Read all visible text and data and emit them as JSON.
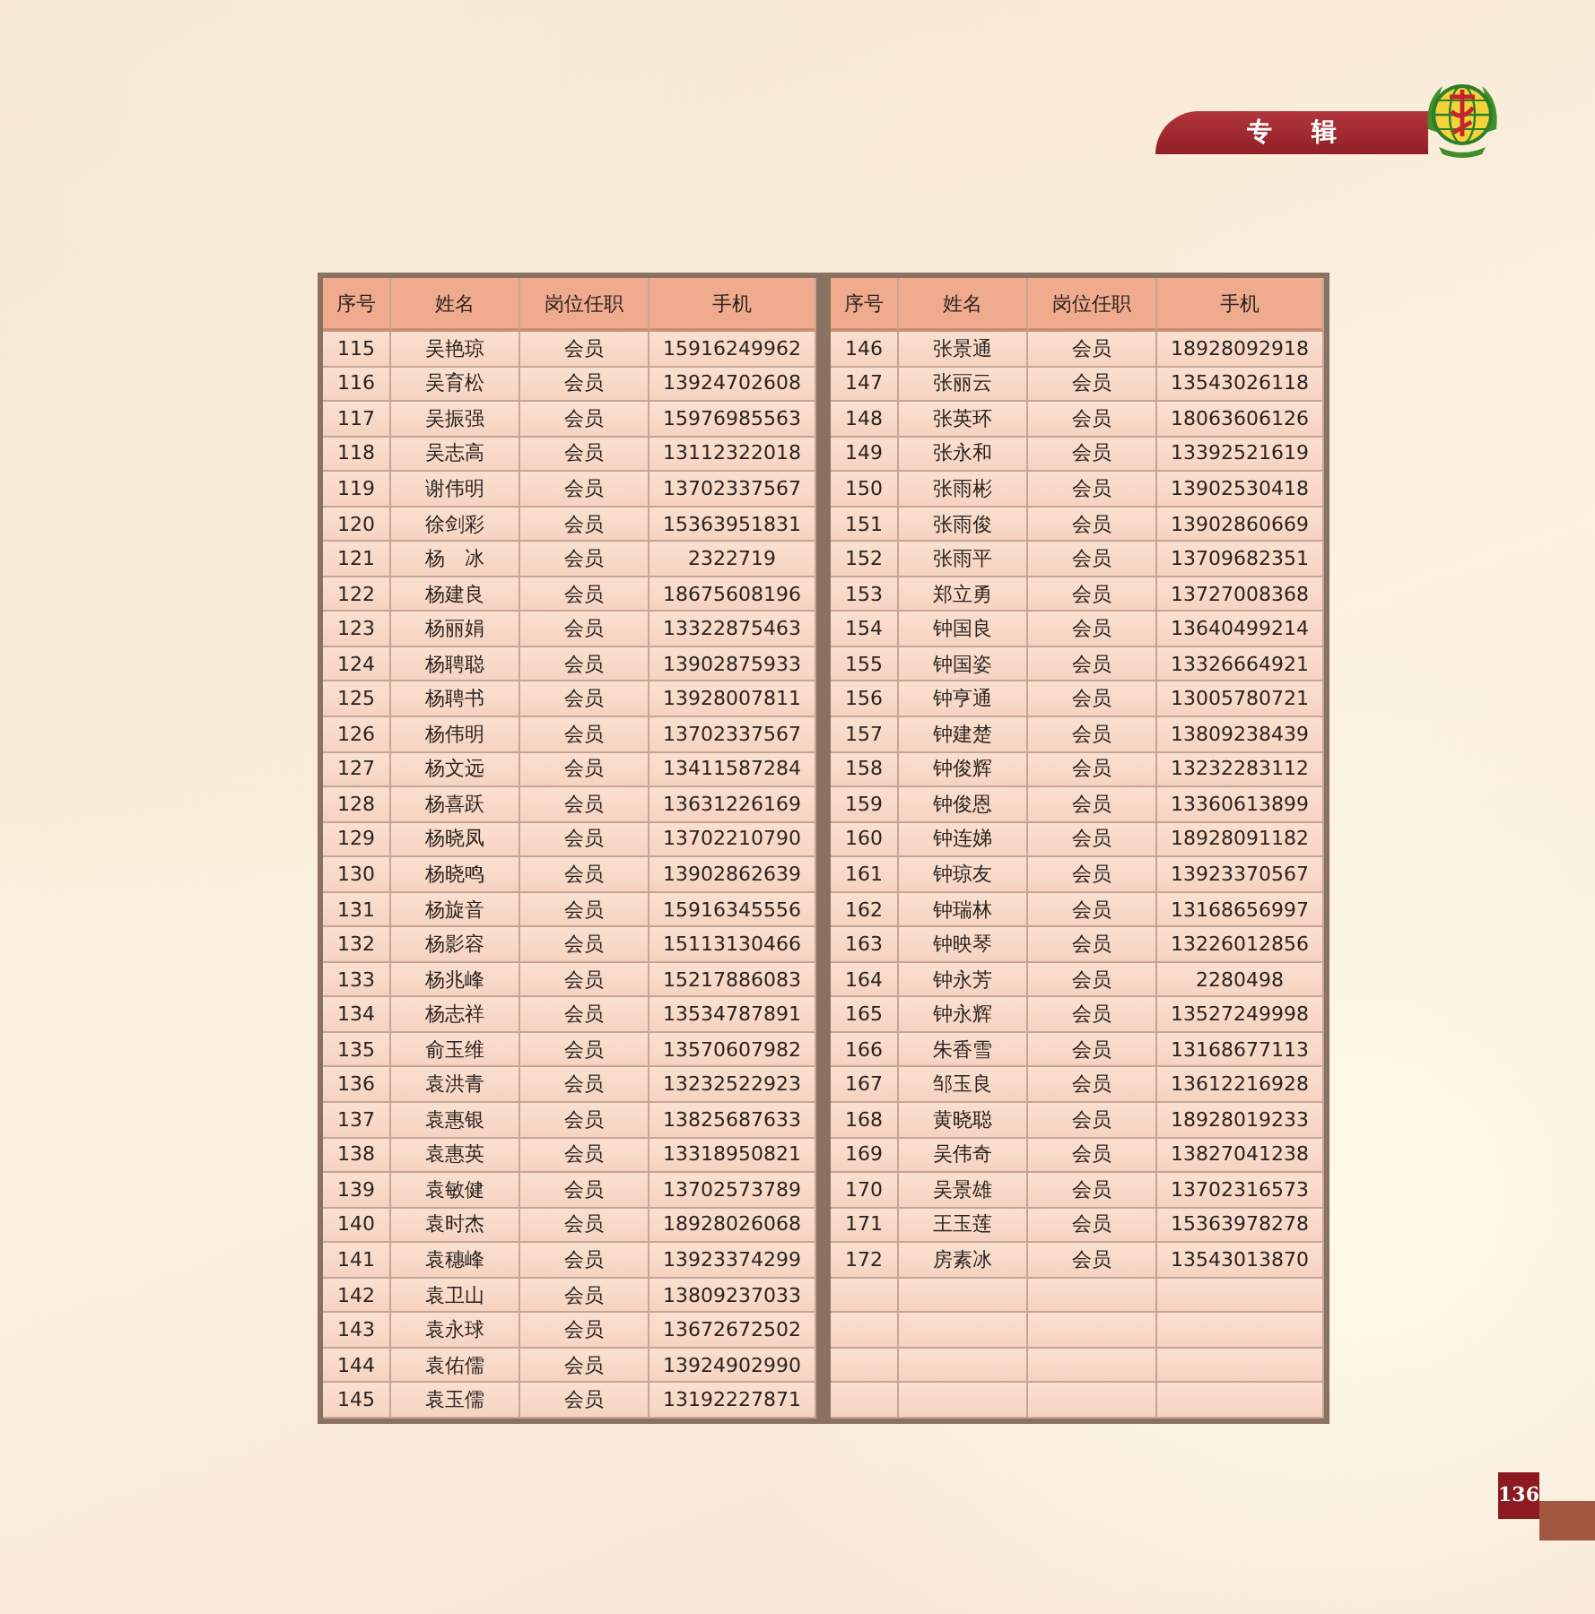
{
  "header": {
    "title": "专辑"
  },
  "tables": [
    {
      "columns": [
        "序号",
        "姓名",
        "岗位任职",
        "手机"
      ],
      "rows": [
        [
          "115",
          "吴艳琼",
          "会员",
          "15916249962"
        ],
        [
          "116",
          "吴育松",
          "会员",
          "13924702608"
        ],
        [
          "117",
          "吴振强",
          "会员",
          "15976985563"
        ],
        [
          "118",
          "吴志高",
          "会员",
          "13112322018"
        ],
        [
          "119",
          "谢伟明",
          "会员",
          "13702337567"
        ],
        [
          "120",
          "徐剑彩",
          "会员",
          "15363951831"
        ],
        [
          "121",
          "杨　冰",
          "会员",
          "2322719"
        ],
        [
          "122",
          "杨建良",
          "会员",
          "18675608196"
        ],
        [
          "123",
          "杨丽娟",
          "会员",
          "13322875463"
        ],
        [
          "124",
          "杨聘聪",
          "会员",
          "13902875933"
        ],
        [
          "125",
          "杨聘书",
          "会员",
          "13928007811"
        ],
        [
          "126",
          "杨伟明",
          "会员",
          "13702337567"
        ],
        [
          "127",
          "杨文远",
          "会员",
          "13411587284"
        ],
        [
          "128",
          "杨喜跃",
          "会员",
          "13631226169"
        ],
        [
          "129",
          "杨晓凤",
          "会员",
          "13702210790"
        ],
        [
          "130",
          "杨晓鸣",
          "会员",
          "13902862639"
        ],
        [
          "131",
          "杨旋音",
          "会员",
          "15916345556"
        ],
        [
          "132",
          "杨影容",
          "会员",
          "15113130466"
        ],
        [
          "133",
          "杨兆峰",
          "会员",
          "15217886083"
        ],
        [
          "134",
          "杨志祥",
          "会员",
          "13534787891"
        ],
        [
          "135",
          "俞玉维",
          "会员",
          "13570607982"
        ],
        [
          "136",
          "袁洪青",
          "会员",
          "13232522923"
        ],
        [
          "137",
          "袁惠银",
          "会员",
          "13825687633"
        ],
        [
          "138",
          "袁惠英",
          "会员",
          "13318950821"
        ],
        [
          "139",
          "袁敏健",
          "会员",
          "13702573789"
        ],
        [
          "140",
          "袁时杰",
          "会员",
          "18928026068"
        ],
        [
          "141",
          "袁穗峰",
          "会员",
          "13923374299"
        ],
        [
          "142",
          "袁卫山",
          "会员",
          "13809237033"
        ],
        [
          "143",
          "袁永球",
          "会员",
          "13672672502"
        ],
        [
          "144",
          "袁佑儒",
          "会员",
          "13924902990"
        ],
        [
          "145",
          "袁玉儒",
          "会员",
          "13192227871"
        ]
      ]
    },
    {
      "columns": [
        "序号",
        "姓名",
        "岗位任职",
        "手机"
      ],
      "rows": [
        [
          "146",
          "张景通",
          "会员",
          "18928092918"
        ],
        [
          "147",
          "张丽云",
          "会员",
          "13543026118"
        ],
        [
          "148",
          "张英环",
          "会员",
          "18063606126"
        ],
        [
          "149",
          "张永和",
          "会员",
          "13392521619"
        ],
        [
          "150",
          "张雨彬",
          "会员",
          "13902530418"
        ],
        [
          "151",
          "张雨俊",
          "会员",
          "13902860669"
        ],
        [
          "152",
          "张雨平",
          "会员",
          "13709682351"
        ],
        [
          "153",
          "郑立勇",
          "会员",
          "13727008368"
        ],
        [
          "154",
          "钟国良",
          "会员",
          "13640499214"
        ],
        [
          "155",
          "钟国姿",
          "会员",
          "13326664921"
        ],
        [
          "156",
          "钟亨通",
          "会员",
          "13005780721"
        ],
        [
          "157",
          "钟建楚",
          "会员",
          "13809238439"
        ],
        [
          "158",
          "钟俊辉",
          "会员",
          "13232283112"
        ],
        [
          "159",
          "钟俊恩",
          "会员",
          "13360613899"
        ],
        [
          "160",
          "钟连娣",
          "会员",
          "18928091182"
        ],
        [
          "161",
          "钟琼友",
          "会员",
          "13923370567"
        ],
        [
          "162",
          "钟瑞林",
          "会员",
          "13168656997"
        ],
        [
          "163",
          "钟映琴",
          "会员",
          "13226012856"
        ],
        [
          "164",
          "钟永芳",
          "会员",
          "2280498"
        ],
        [
          "165",
          "钟永辉",
          "会员",
          "13527249998"
        ],
        [
          "166",
          "朱香雪",
          "会员",
          "13168677113"
        ],
        [
          "167",
          "邹玉良",
          "会员",
          "13612216928"
        ],
        [
          "168",
          "黄晓聪",
          "会员",
          "18928019233"
        ],
        [
          "169",
          "吴伟奇",
          "会员",
          "13827041238"
        ],
        [
          "170",
          "吴景雄",
          "会员",
          "13702316573"
        ],
        [
          "171",
          "王玉莲",
          "会员",
          "15363978278"
        ],
        [
          "172",
          "房素冰",
          "会员",
          "13543013870"
        ]
      ]
    }
  ],
  "page_number": "136"
}
